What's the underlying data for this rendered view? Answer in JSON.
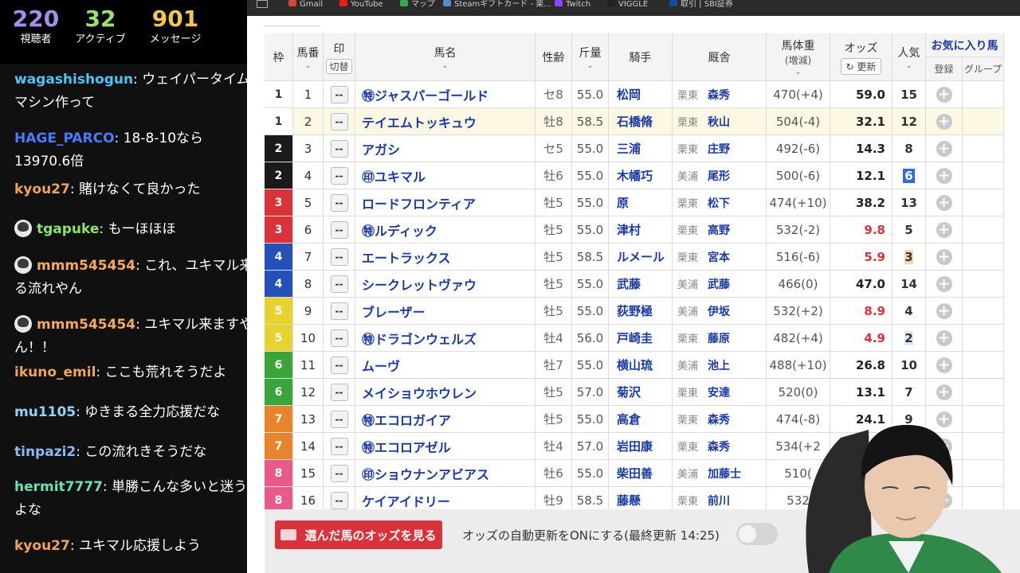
{
  "stats": [
    {
      "value": "220",
      "label": "視聴者",
      "color": "#a98cf0"
    },
    {
      "value": "32",
      "label": "アクティブ",
      "color": "#9be36a"
    },
    {
      "value": "901",
      "label": "メッセージ",
      "color": "#f2c94c"
    }
  ],
  "chat": [
    {
      "user": "wagashishogun",
      "text": "ウェイパータイムマシン作って",
      "color": "#4fc3f7",
      "avatar": false
    },
    {
      "user": "HAGE_PARCO",
      "text": "18-8-10なら13970.6倍",
      "color": "#4a7bff",
      "avatar": false
    },
    {
      "user": "kyou27",
      "text": "賭けなくて良かった",
      "color": "#f0a35a",
      "avatar": false
    },
    {
      "user": "tgapuke",
      "text": "もーほほほ",
      "color": "#8be36a",
      "avatar": true
    },
    {
      "user": "mmm545454",
      "text": "これ、ユキマル来る流れやん",
      "color": "#f5a962",
      "avatar": true
    },
    {
      "user": "mmm545454",
      "text": "ユキマル来ますやん！！",
      "color": "#f5a962",
      "avatar": true
    },
    {
      "user": "ikuno_emil",
      "text": "ここも荒れそうだよ",
      "color": "#f0a35a",
      "avatar": false
    },
    {
      "user": "mu1105",
      "text": "ゆきまる全力応援だな",
      "color": "#8fd3f7",
      "avatar": false
    },
    {
      "user": "tinpazi2",
      "text": "この流れきそうだな",
      "color": "#8fb8f7",
      "avatar": false
    },
    {
      "user": "hermit7777",
      "text": "単勝こんな多いと迷うよな",
      "color": "#6ee0b8",
      "avatar": false
    },
    {
      "user": "kyou27",
      "text": "ユキマル応援しよう",
      "color": "#f0a35a",
      "avatar": false
    }
  ],
  "bookmarks": [
    {
      "label": "Gmail",
      "color": "#d44638"
    },
    {
      "label": "YouTube",
      "color": "#e62117"
    },
    {
      "label": "マップ",
      "color": "#34a853"
    },
    {
      "label": "Steamギフトカード - 楽...",
      "color": "#5a8dc8"
    },
    {
      "label": "Twitch",
      "color": "#9146ff"
    },
    {
      "label": "VIGGLE",
      "color": "#222222"
    },
    {
      "label": "取引 | SBI証券",
      "color": "#1a4a9a"
    }
  ],
  "table": {
    "headers": {
      "waku": "枠",
      "umaban": "馬番",
      "mark": "印",
      "mark_toggle": "切替",
      "name": "馬名",
      "sexage": "性齢",
      "weight": "斤量",
      "jockey": "騎手",
      "stable": "厩舎",
      "bodyweight": "馬体重",
      "bodyweight_sub": "(増減)",
      "odds": "オッズ",
      "odds_refresh": "更新",
      "popularity": "人気",
      "favorites": "お気に入り馬",
      "fav_register": "登録",
      "fav_group": "グループ"
    },
    "mark_placeholder": "--",
    "rows": [
      {
        "waku": "1",
        "waku_color": "#ffffff",
        "waku_text_color": "#333333",
        "num": "1",
        "name": "㊕ジャスパーゴールド",
        "sexage": "セ8",
        "weight": "55.0",
        "jockey": "松岡",
        "stable_reg": "栗東",
        "stable_name": "森秀",
        "bodyweight": "470(+4)",
        "odds": "59.0",
        "hot": false,
        "pop": "15",
        "pop_hl": ""
      },
      {
        "waku": "1",
        "waku_color": "#ffffff",
        "waku_text_color": "#333333",
        "num": "2",
        "name": "テイエムトッキュウ",
        "sexage": "牡8",
        "weight": "58.5",
        "jockey": "石橋脩",
        "stable_reg": "栗東",
        "stable_name": "秋山",
        "bodyweight": "504(-4)",
        "odds": "32.1",
        "hot": false,
        "pop": "12",
        "pop_hl": "",
        "highlight": true
      },
      {
        "waku": "2",
        "waku_color": "#1a1a1a",
        "waku_text_color": "#ffffff",
        "num": "3",
        "name": "アガシ",
        "sexage": "セ5",
        "weight": "55.0",
        "jockey": "三浦",
        "stable_reg": "栗東",
        "stable_name": "庄野",
        "bodyweight": "492(-6)",
        "odds": "14.3",
        "hot": false,
        "pop": "8",
        "pop_hl": ""
      },
      {
        "waku": "2",
        "waku_color": "#1a1a1a",
        "waku_text_color": "#ffffff",
        "num": "4",
        "name": "㊞ユキマル",
        "sexage": "牡6",
        "weight": "55.0",
        "jockey": "木幡巧",
        "stable_reg": "美浦",
        "stable_name": "尾形",
        "bodyweight": "500(-6)",
        "odds": "12.1",
        "hot": false,
        "pop": "6",
        "pop_hl": "p1"
      },
      {
        "waku": "3",
        "waku_color": "#d9323a",
        "waku_text_color": "#ffffff",
        "num": "5",
        "name": "ロードフロンティア",
        "sexage": "牡5",
        "weight": "55.0",
        "jockey": "原",
        "stable_reg": "栗東",
        "stable_name": "松下",
        "bodyweight": "474(+10)",
        "odds": "38.2",
        "hot": false,
        "pop": "13",
        "pop_hl": ""
      },
      {
        "waku": "3",
        "waku_color": "#d9323a",
        "waku_text_color": "#ffffff",
        "num": "6",
        "name": "㊕ルディック",
        "sexage": "牡5",
        "weight": "55.0",
        "jockey": "津村",
        "stable_reg": "栗東",
        "stable_name": "高野",
        "bodyweight": "532(-2)",
        "odds": "9.8",
        "hot": true,
        "pop": "5",
        "pop_hl": ""
      },
      {
        "waku": "4",
        "waku_color": "#2450b8",
        "waku_text_color": "#ffffff",
        "num": "7",
        "name": "エートラックス",
        "sexage": "牡5",
        "weight": "58.5",
        "jockey": "ルメール",
        "stable_reg": "栗東",
        "stable_name": "宮本",
        "bodyweight": "516(-6)",
        "odds": "5.9",
        "hot": true,
        "pop": "3",
        "pop_hl": "p3"
      },
      {
        "waku": "4",
        "waku_color": "#2450b8",
        "waku_text_color": "#ffffff",
        "num": "8",
        "name": "シークレットヴァウ",
        "sexage": "牡5",
        "weight": "55.0",
        "jockey": "武藤",
        "stable_reg": "美浦",
        "stable_name": "武藤",
        "bodyweight": "466(0)",
        "odds": "47.0",
        "hot": false,
        "pop": "14",
        "pop_hl": ""
      },
      {
        "waku": "5",
        "waku_color": "#e8d230",
        "waku_text_color": "#ffffff",
        "num": "9",
        "name": "ブレーザー",
        "sexage": "牡5",
        "weight": "55.0",
        "jockey": "荻野極",
        "stable_reg": "美浦",
        "stable_name": "伊坂",
        "bodyweight": "532(+2)",
        "odds": "8.9",
        "hot": true,
        "pop": "4",
        "pop_hl": ""
      },
      {
        "waku": "5",
        "waku_color": "#e8d230",
        "waku_text_color": "#ffffff",
        "num": "10",
        "name": "㊕ドラゴンウェルズ",
        "sexage": "牡4",
        "weight": "56.0",
        "jockey": "戸崎圭",
        "stable_reg": "栗東",
        "stable_name": "藤原",
        "bodyweight": "482(+4)",
        "odds": "4.9",
        "hot": true,
        "pop": "2",
        "pop_hl": "p2"
      },
      {
        "waku": "6",
        "waku_color": "#3aa53a",
        "waku_text_color": "#ffffff",
        "num": "11",
        "name": "ムーヴ",
        "sexage": "牡7",
        "weight": "55.0",
        "jockey": "横山琉",
        "stable_reg": "美浦",
        "stable_name": "池上",
        "bodyweight": "488(+10)",
        "odds": "26.8",
        "hot": false,
        "pop": "10",
        "pop_hl": ""
      },
      {
        "waku": "6",
        "waku_color": "#3aa53a",
        "waku_text_color": "#ffffff",
        "num": "12",
        "name": "メイショウホウレン",
        "sexage": "牡5",
        "weight": "57.0",
        "jockey": "菊沢",
        "stable_reg": "栗東",
        "stable_name": "安達",
        "bodyweight": "520(0)",
        "odds": "13.1",
        "hot": false,
        "pop": "7",
        "pop_hl": ""
      },
      {
        "waku": "7",
        "waku_color": "#e8842a",
        "waku_text_color": "#ffffff",
        "num": "13",
        "name": "㊕エコロガイア",
        "sexage": "牡5",
        "weight": "55.0",
        "jockey": "高倉",
        "stable_reg": "栗東",
        "stable_name": "森秀",
        "bodyweight": "474(-8)",
        "odds": "24.1",
        "hot": false,
        "pop": "9",
        "pop_hl": ""
      },
      {
        "waku": "7",
        "waku_color": "#e8842a",
        "waku_text_color": "#ffffff",
        "num": "14",
        "name": "㊕エコロアゼル",
        "sexage": "牡4",
        "weight": "57.0",
        "jockey": "岩田康",
        "stable_reg": "栗東",
        "stable_name": "森秀",
        "bodyweight": "534(+2",
        "odds": "",
        "hot": false,
        "pop": "",
        "pop_hl": ""
      },
      {
        "waku": "8",
        "waku_color": "#e85a8a",
        "waku_text_color": "#ffffff",
        "num": "15",
        "name": "㊞ショウナンアビアス",
        "sexage": "牡6",
        "weight": "55.0",
        "jockey": "柴田善",
        "stable_reg": "美浦",
        "stable_name": "加藤士",
        "bodyweight": "510(",
        "odds": "",
        "hot": false,
        "pop": "",
        "pop_hl": ""
      },
      {
        "waku": "8",
        "waku_color": "#e85a8a",
        "waku_text_color": "#ffffff",
        "num": "16",
        "name": "ケイアイドリー",
        "sexage": "牡9",
        "weight": "58.5",
        "jockey": "藤懸",
        "stable_reg": "栗東",
        "stable_name": "前川",
        "bodyweight": "532",
        "odds": "",
        "hot": false,
        "pop": "",
        "pop_hl": ""
      }
    ]
  },
  "bottom": {
    "odds_button": "選んだ馬のオッズを見る",
    "auto_update": "オッズの自動更新をONにする(最終更新 14:25)"
  },
  "icons": {
    "refresh": "refresh-icon",
    "add_favorite": "plus-circle-icon",
    "chart": "chart-icon",
    "grid": "grid-icon"
  }
}
